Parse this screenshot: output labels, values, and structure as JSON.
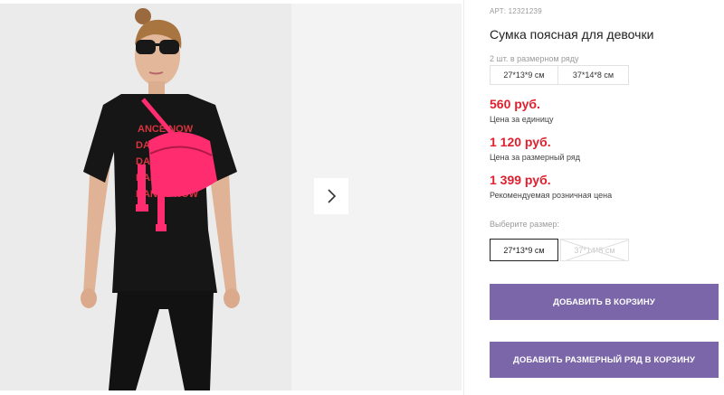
{
  "product": {
    "article": "АРТ: 12321239",
    "title": "Сумка поясная для девочки",
    "print_text": "ANCE NOW"
  },
  "pack": {
    "label": "2 шт. в размерном ряду",
    "sizes": [
      "27*13*9 см",
      "37*14*8 см"
    ]
  },
  "prices": [
    {
      "value": "560 руб.",
      "note": "Цена за единицу"
    },
    {
      "value": "1 120 руб.",
      "note": "Цена за размерный ряд"
    },
    {
      "value": "1 399 руб.",
      "note": "Рекомендуемая розничная цена"
    }
  ],
  "size_select": {
    "label": "Выберите размер:",
    "options": [
      {
        "label": "27*13*9 см",
        "state": "selected"
      },
      {
        "label": "37*14*8 см",
        "state": "unavailable"
      }
    ]
  },
  "buttons": {
    "add_to_cart": "ДОБАВИТЬ В КОРЗИНУ",
    "add_pack_to_cart": "ДОБАВИТЬ РАЗМЕРНЫЙ РЯД В КОРЗИНУ"
  },
  "icons": {
    "next": "chevron-right-icon"
  },
  "colors": {
    "price": "#e0202e",
    "button": "#7a66a8",
    "bag": "#ff2d6f"
  }
}
